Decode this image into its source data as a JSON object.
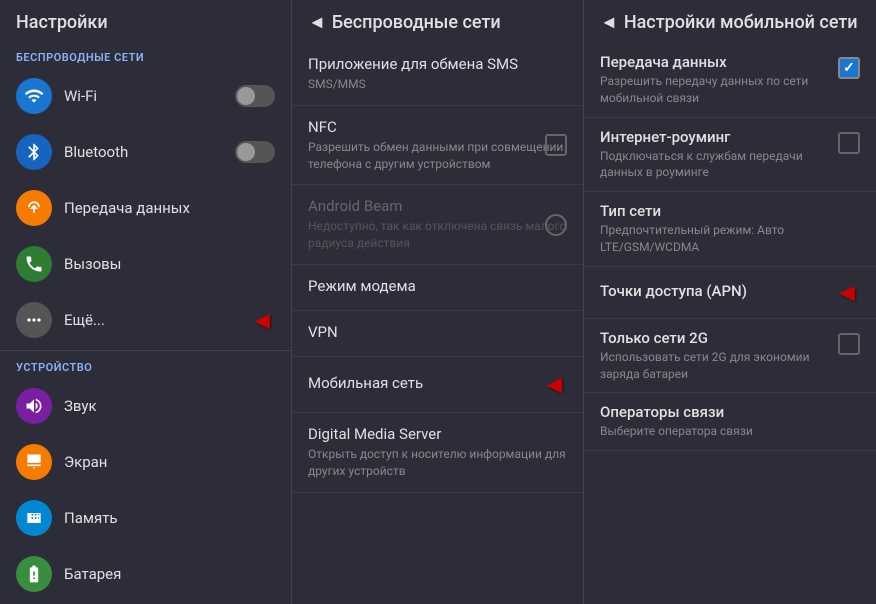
{
  "left_panel": {
    "title": "Настройки",
    "section_wireless": "БЕСПРОВОДНЫЕ СЕТИ",
    "section_device": "УСТРОЙСТВО",
    "items_wireless": [
      {
        "id": "wifi",
        "label": "Wi-Fi",
        "icon_color": "#1976d2",
        "has_toggle": true
      },
      {
        "id": "bluetooth",
        "label": "Bluetooth",
        "icon_color": "#1565c0",
        "has_toggle": true
      },
      {
        "id": "data",
        "label": "Передача данных",
        "icon_color": "#f57c00",
        "has_toggle": false
      },
      {
        "id": "calls",
        "label": "Вызовы",
        "icon_color": "#2e7d32",
        "has_toggle": false
      },
      {
        "id": "more",
        "label": "Ещё...",
        "icon_color": "#555",
        "has_toggle": false,
        "has_arrow": true
      }
    ],
    "items_device": [
      {
        "id": "sound",
        "label": "Звук",
        "icon_color": "#7b1fa2"
      },
      {
        "id": "screen",
        "label": "Экран",
        "icon_color": "#f57c00"
      },
      {
        "id": "memory",
        "label": "Память",
        "icon_color": "#0288d1"
      },
      {
        "id": "battery",
        "label": "Батарея",
        "icon_color": "#388e3c"
      }
    ]
  },
  "middle_panel": {
    "title": "Беспроводные сети",
    "items": [
      {
        "id": "sms",
        "title": "Приложение для обмена SMS",
        "sub": "SMS/MMS",
        "disabled": false,
        "has_checkbox": false
      },
      {
        "id": "nfc",
        "title": "NFC",
        "sub": "Разрешить обмен данными при совмещении телефона с другим устройством",
        "disabled": false,
        "has_checkbox": true
      },
      {
        "id": "android_beam",
        "title": "Android Beam",
        "sub": "Недоступно, так как отключена связь малого радиуса действия",
        "disabled": true,
        "has_radio": true
      },
      {
        "id": "modem",
        "title": "Режим модема",
        "sub": "",
        "disabled": false,
        "has_checkbox": false
      },
      {
        "id": "vpn",
        "title": "VPN",
        "sub": "",
        "disabled": false,
        "has_checkbox": false
      },
      {
        "id": "mobile_network",
        "title": "Мобильная сеть",
        "sub": "",
        "disabled": false,
        "has_arrow": true
      },
      {
        "id": "dms",
        "title": "Digital Media Server",
        "sub": "Открыть доступ к носителю информации для других устройств",
        "disabled": false,
        "has_checkbox": false
      }
    ]
  },
  "right_panel": {
    "title": "Настройки мобильной сети",
    "items": [
      {
        "id": "data_transfer",
        "title": "Передача данных",
        "sub": "Разрешить передачу данных по сети мобильной связи",
        "checked": true
      },
      {
        "id": "roaming",
        "title": "Интернет-роуминг",
        "sub": "Подключаться к службам передачи данных в роуминге",
        "checked": false
      },
      {
        "id": "network_type",
        "title": "Тип сети",
        "sub": "Предпочтительный режим: Авто LTE/GSM/WCDMA",
        "checked": null
      },
      {
        "id": "apn",
        "title": "Точки доступа (APN)",
        "sub": "",
        "checked": null,
        "has_arrow": true
      },
      {
        "id": "only_2g",
        "title": "Только сети 2G",
        "sub": "Использовать сети 2G для экономии заряда батареи",
        "checked": false
      },
      {
        "id": "operators",
        "title": "Операторы связи",
        "sub": "Выберите оператора связи",
        "checked": null
      }
    ]
  }
}
